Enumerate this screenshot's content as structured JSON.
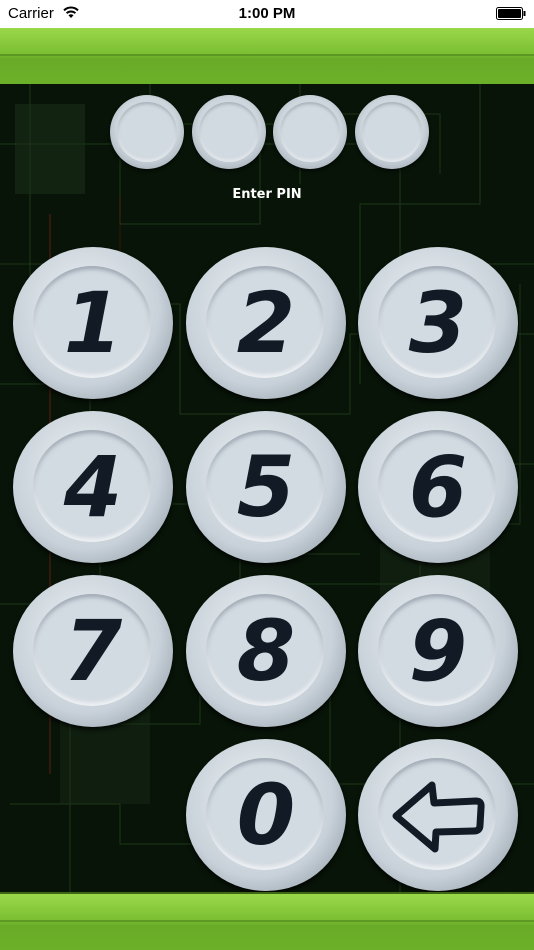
{
  "status_bar": {
    "carrier": "Carrier",
    "time": "1:00 PM",
    "wifi_icon": "wifi-icon",
    "battery_icon": "battery-icon"
  },
  "pin": {
    "label": "Enter PIN",
    "dots_total": 4,
    "dots_filled": 0
  },
  "keypad": {
    "keys": [
      {
        "label": "1"
      },
      {
        "label": "2"
      },
      {
        "label": "3"
      },
      {
        "label": "4"
      },
      {
        "label": "5"
      },
      {
        "label": "6"
      },
      {
        "label": "7"
      },
      {
        "label": "8"
      },
      {
        "label": "9"
      },
      {
        "label": "0"
      }
    ],
    "backspace_icon": "backspace-arrow-icon"
  },
  "colors": {
    "bar_green": "#7cbf33",
    "background": "#081408",
    "button_face": "#d3dbe2",
    "digit": "#121a26"
  }
}
